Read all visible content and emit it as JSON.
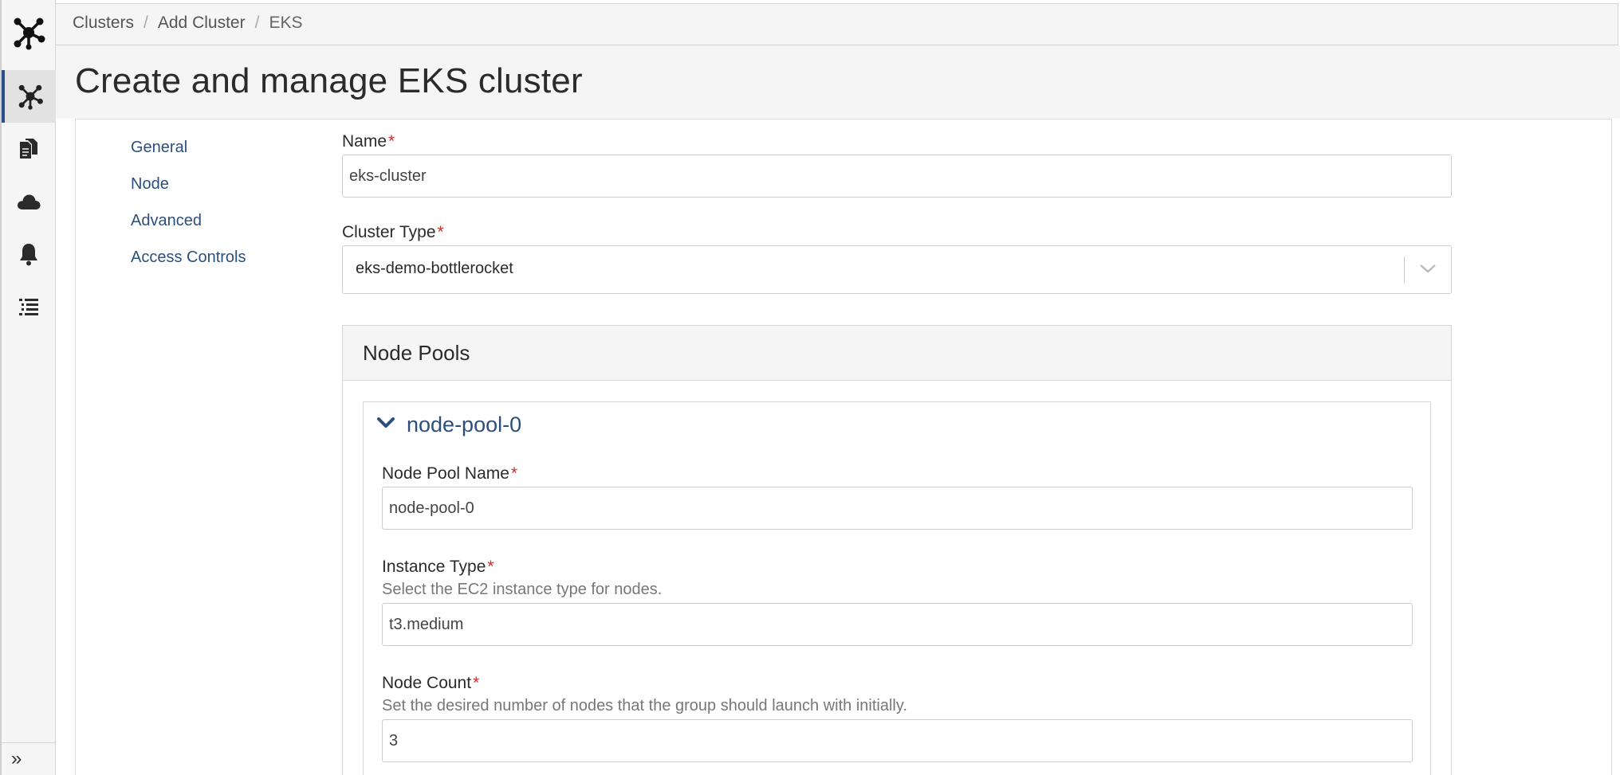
{
  "breadcrumb": {
    "items": [
      "Clusters",
      "Add Cluster"
    ],
    "current": "EKS"
  },
  "page": {
    "title": "Create and manage EKS cluster"
  },
  "side_nav": {
    "items": [
      "General",
      "Node",
      "Advanced",
      "Access Controls"
    ]
  },
  "rail": {
    "icons": [
      "cluster-logo-icon",
      "cluster-icon",
      "documents-icon",
      "cloud-icon",
      "bell-icon",
      "list-icon"
    ],
    "expand_glyph": "»",
    "accent": "#2c4f8a"
  },
  "form": {
    "name_label": "Name",
    "name_value": "eks-cluster",
    "cluster_type_label": "Cluster Type",
    "cluster_type_value": "eks-demo-bottlerocket",
    "required_marker": "*"
  },
  "node_pools": {
    "title": "Node Pools",
    "pool": {
      "name": "node-pool-0",
      "pool_name_label": "Node Pool Name",
      "pool_name_value": "node-pool-0",
      "instance_type_label": "Instance Type",
      "instance_type_help": "Select the EC2 instance type for nodes.",
      "instance_type_value": "t3.medium",
      "node_count_label": "Node Count",
      "node_count_help": "Set the desired number of nodes that the group should launch with initially.",
      "node_count_value": "3"
    }
  },
  "colors": {
    "link": "#2c4f7c",
    "required": "#c9302c",
    "band": "#f5f5f5"
  }
}
